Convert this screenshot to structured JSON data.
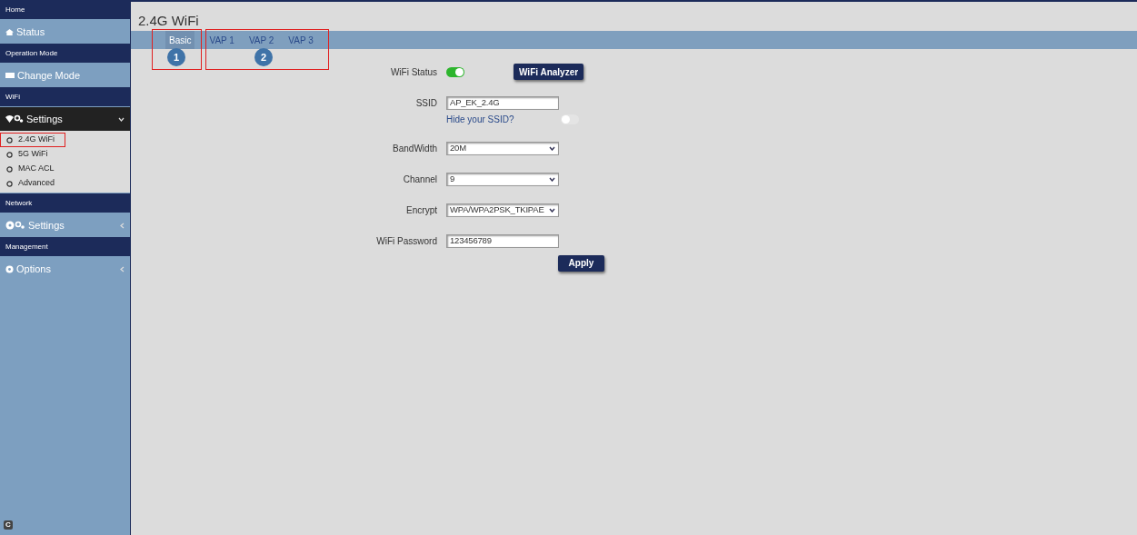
{
  "sidebar": {
    "sections": [
      {
        "header": "Home",
        "items": [
          {
            "label": "Status",
            "expanded": false
          }
        ]
      },
      {
        "header": "Operation Mode",
        "items": [
          {
            "label": "Change Mode",
            "expanded": false
          }
        ]
      },
      {
        "header": "WiFi",
        "items": [
          {
            "label": "Settings",
            "expanded": true,
            "children": [
              {
                "label": "2.4G WiFi",
                "selected": true
              },
              {
                "label": "5G WiFi",
                "selected": false
              },
              {
                "label": "MAC ACL",
                "selected": false
              },
              {
                "label": "Advanced",
                "selected": false
              }
            ]
          }
        ]
      },
      {
        "header": "Network",
        "items": [
          {
            "label": "Settings",
            "expanded": false
          }
        ]
      },
      {
        "header": "Management",
        "items": [
          {
            "label": "Options",
            "expanded": false
          }
        ]
      }
    ],
    "footer_badge": "C"
  },
  "page": {
    "title": "2.4G WiFi"
  },
  "tabs": [
    {
      "label": "Basic",
      "selected": true
    },
    {
      "label": "VAP 1",
      "selected": false
    },
    {
      "label": "VAP 2",
      "selected": false
    },
    {
      "label": "VAP 3",
      "selected": false
    }
  ],
  "annotations": [
    {
      "number": "1"
    },
    {
      "number": "2"
    }
  ],
  "form": [
    {
      "kind": "toggle",
      "label": "WiFi Status",
      "on": true,
      "button": "WiFi Analyzer"
    },
    {
      "kind": "text",
      "label": "SSID",
      "value": "AP_EK_2.4G",
      "hint": "Hide your SSID?",
      "hint_on": false
    },
    {
      "kind": "select",
      "label": "BandWidth",
      "value": "20M"
    },
    {
      "kind": "select",
      "label": "Channel",
      "value": "9"
    },
    {
      "kind": "select",
      "label": "Encrypt",
      "value": "WPA/WPA2PSK_TKIPAE"
    },
    {
      "kind": "text",
      "label": "WiFi Password",
      "value": "123456789"
    }
  ],
  "apply_button": "Apply"
}
